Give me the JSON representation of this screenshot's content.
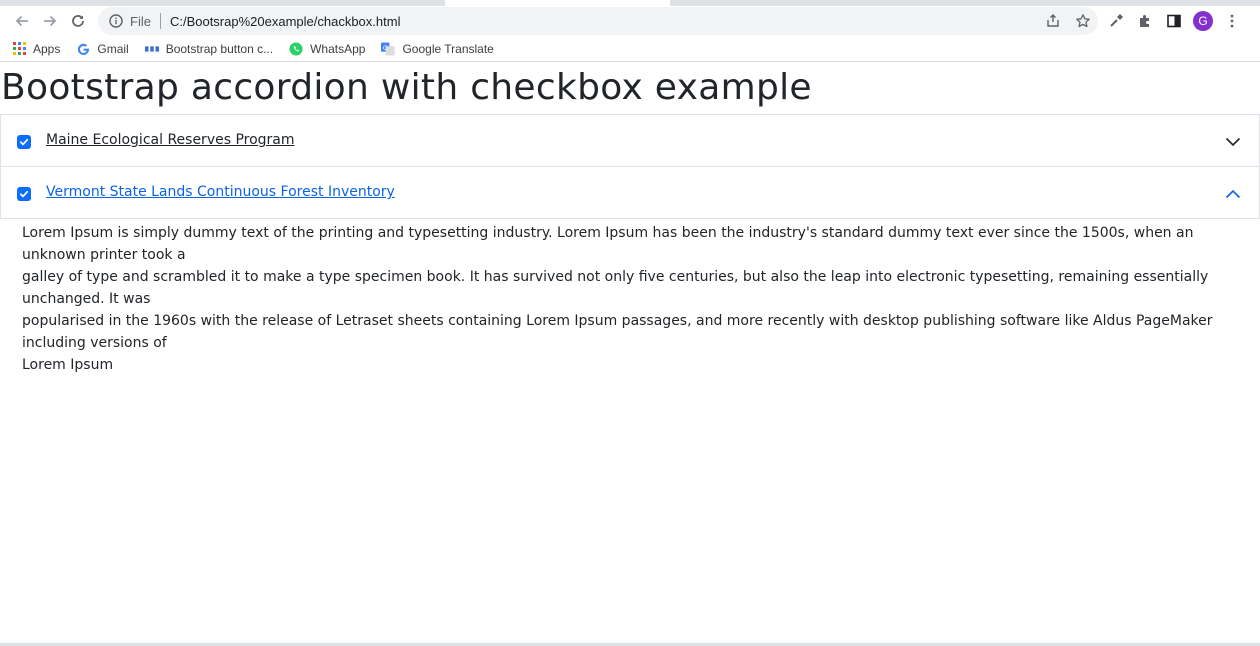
{
  "browser": {
    "address": {
      "scheme_label": "File",
      "url": "C:/Bootsrap%20example/chackbox.html"
    },
    "profile_initial": "G",
    "bookmarks": [
      {
        "label": "Apps",
        "icon": "apps-grid-icon"
      },
      {
        "label": "Gmail",
        "icon": "google-g-icon"
      },
      {
        "label": "Bootstrap button c...",
        "icon": "mdb-icon"
      },
      {
        "label": "WhatsApp",
        "icon": "whatsapp-icon"
      },
      {
        "label": "Google Translate",
        "icon": "google-translate-icon"
      }
    ]
  },
  "page": {
    "title": "Bootstrap accordion with checkbox example",
    "accordion": [
      {
        "label": "Maine Ecological Reserves Program",
        "checked": true,
        "expanded": false
      },
      {
        "label": "Vermont State Lands Continuous Forest Inventory",
        "checked": true,
        "expanded": true
      }
    ],
    "body_text": "Lorem Ipsum is simply dummy text of the printing and typesetting industry. Lorem Ipsum has been the industry's standard dummy text ever since the 1500s, when an unknown printer took a\ngalley of type and scrambled it to make a type specimen book. It has survived not only five centuries, but also the leap into electronic typesetting, remaining essentially unchanged. It was\npopularised in the 1960s with the release of Letraset sheets containing Lorem Ipsum passages, and more recently with desktop publishing software like Aldus PageMaker including versions of\nLorem Ipsum"
  },
  "colors": {
    "checkbox": "#0d6efd",
    "expanded_link": "#0c63e4",
    "avatar": "#8430ce"
  }
}
